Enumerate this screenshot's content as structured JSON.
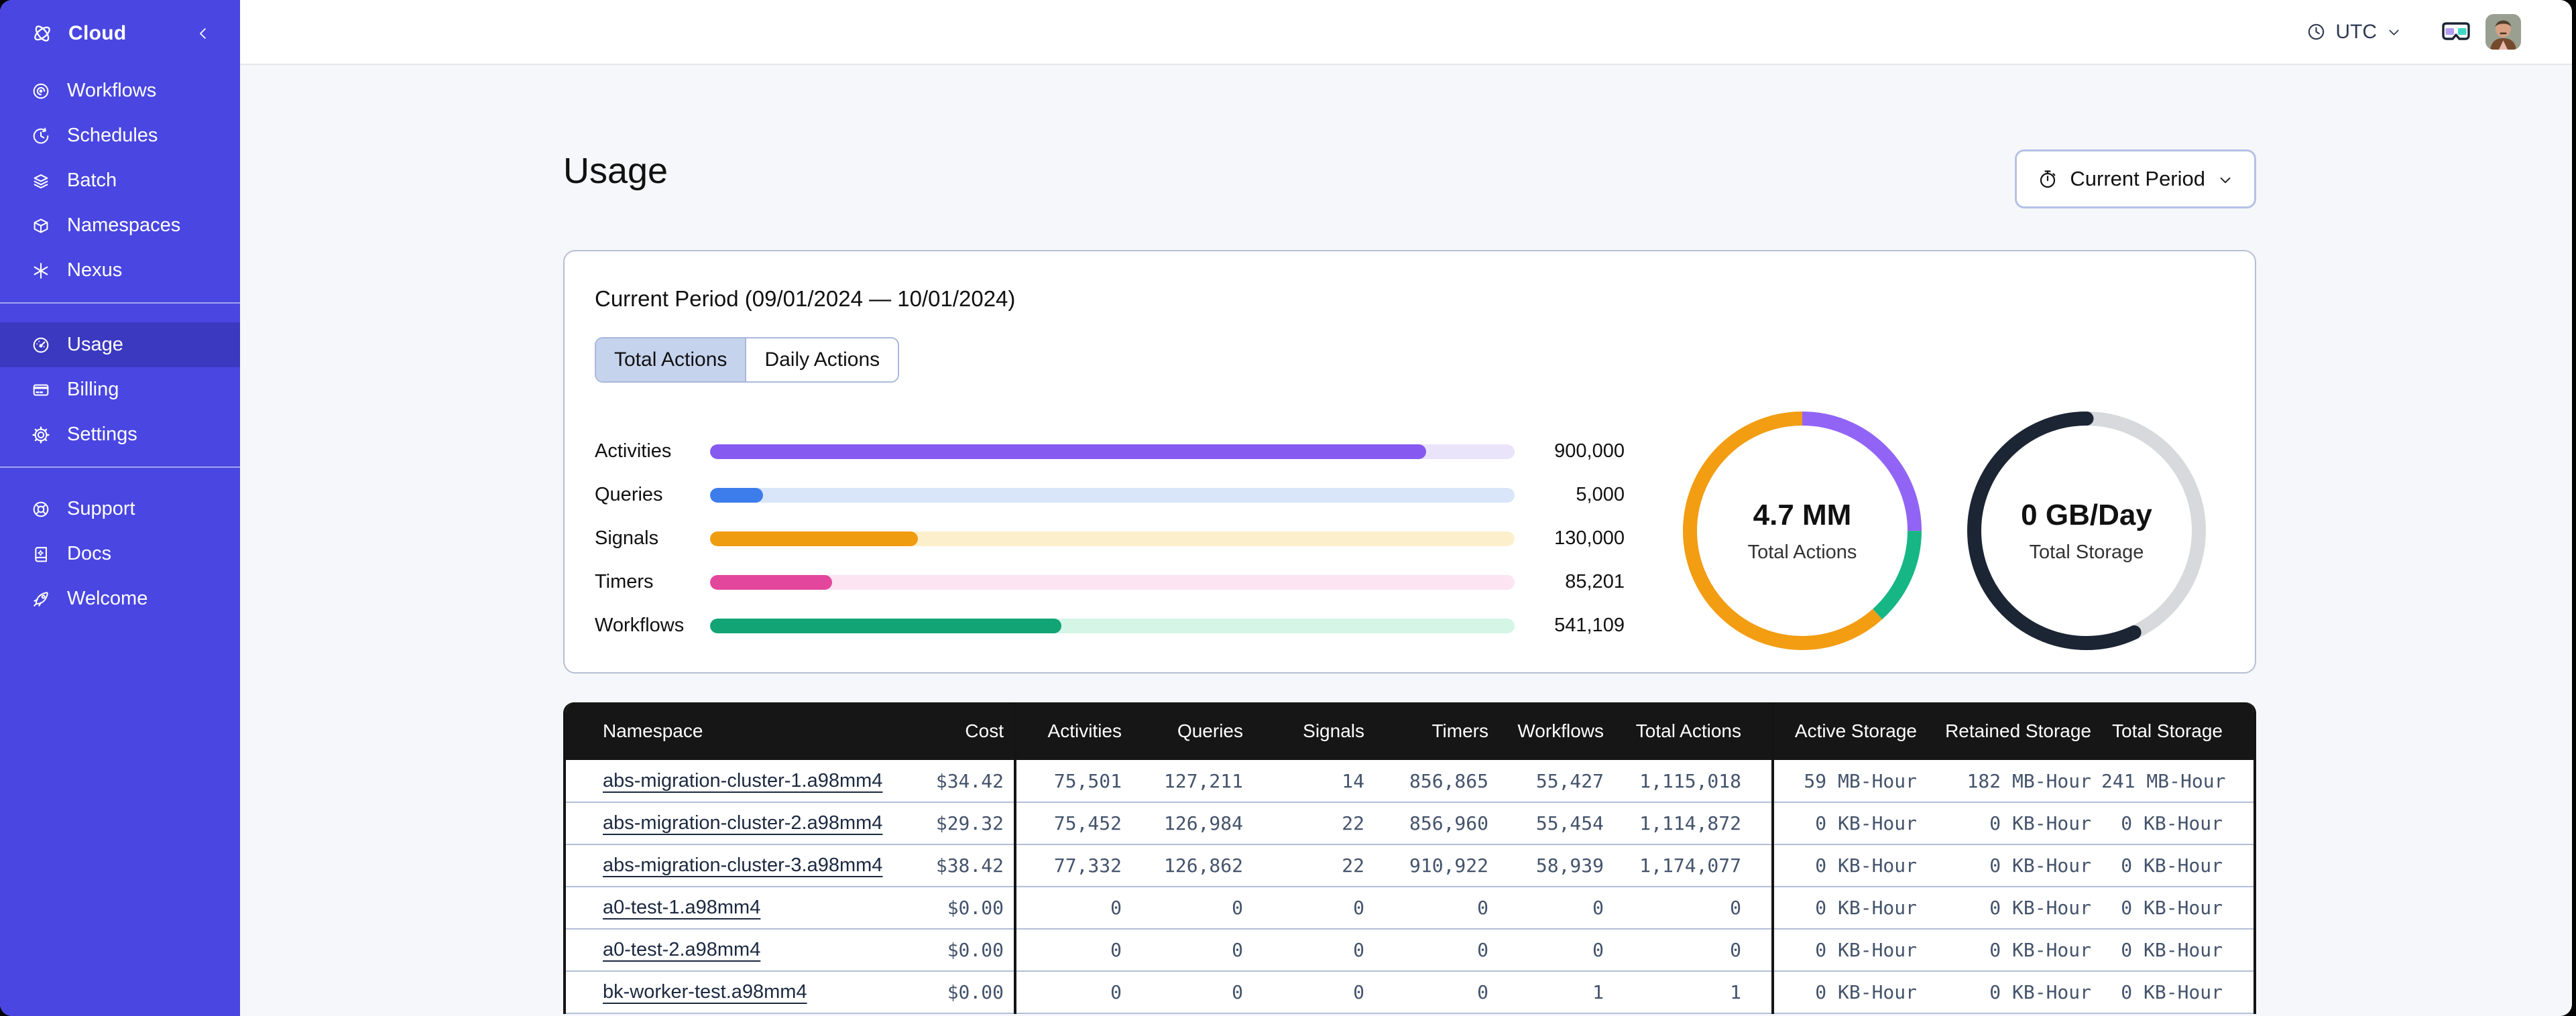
{
  "sidebar": {
    "brand": {
      "label": "Cloud"
    },
    "groups": [
      {
        "items": [
          {
            "icon": "workflows-icon",
            "label": "Workflows",
            "active": false
          },
          {
            "icon": "schedules-icon",
            "label": "Schedules",
            "active": false
          },
          {
            "icon": "batch-icon",
            "label": "Batch",
            "active": false
          },
          {
            "icon": "namespaces-icon",
            "label": "Namespaces",
            "active": false
          },
          {
            "icon": "nexus-icon",
            "label": "Nexus",
            "active": false
          }
        ]
      },
      {
        "items": [
          {
            "icon": "usage-icon",
            "label": "Usage",
            "active": true
          },
          {
            "icon": "billing-icon",
            "label": "Billing",
            "active": false
          },
          {
            "icon": "settings-icon",
            "label": "Settings",
            "active": false
          }
        ]
      },
      {
        "items": [
          {
            "icon": "support-icon",
            "label": "Support",
            "active": false
          },
          {
            "icon": "docs-icon",
            "label": "Docs",
            "active": false
          },
          {
            "icon": "welcome-icon",
            "label": "Welcome",
            "active": false
          }
        ]
      }
    ]
  },
  "topbar": {
    "timezone": "UTC"
  },
  "page": {
    "title": "Usage",
    "period_button": {
      "label": "Current Period"
    }
  },
  "usage_card": {
    "title": "Current Period (09/01/2024 — 10/01/2024)",
    "tabs": [
      {
        "label": "Total Actions",
        "active": true
      },
      {
        "label": "Daily Actions",
        "active": false
      }
    ]
  },
  "chart_data": [
    {
      "type": "bar",
      "orientation": "horizontal",
      "categories": [
        "Activities",
        "Queries",
        "Signals",
        "Timers",
        "Workflows"
      ],
      "values": [
        900000,
        5000,
        130000,
        85201,
        541109
      ],
      "value_labels": [
        "900,000",
        "5,000",
        "130,000",
        "85,201",
        "541,109"
      ],
      "fill_pct": [
        89,
        6.6,
        25.8,
        15.2,
        43.7
      ],
      "colors": [
        "#8659f0",
        "#3d7ceb",
        "#f09c10",
        "#e2479c",
        "#12a474"
      ],
      "track_colors": [
        "#eae4fb",
        "#d9e6fa",
        "#fcf0cc",
        "#fce4f3",
        "#d5f5e6"
      ],
      "grid": false,
      "legend": "none"
    },
    {
      "type": "donut",
      "center_value": "4.7 MM",
      "center_label": "Total Actions",
      "segments": [
        {
          "name": "activities",
          "color": "#9264f6",
          "pct": 25
        },
        {
          "name": "workflows",
          "color": "#16b685",
          "pct": 13.3
        },
        {
          "name": "signals",
          "color": "#f29d12",
          "pct": 61.7
        }
      ]
    },
    {
      "type": "donut",
      "center_value": "0 GB/Day",
      "center_label": "Total Storage",
      "segments": [
        {
          "name": "remaining",
          "color": "#d8d9dd",
          "pct": 43,
          "cap": "butt"
        },
        {
          "name": "used",
          "color": "#1b2534",
          "pct": 57,
          "cap": "round"
        }
      ]
    }
  ],
  "table": {
    "columns": [
      {
        "key": "namespace",
        "label": "Namespace"
      },
      {
        "key": "cost",
        "label": "Cost"
      },
      {
        "key": "activities",
        "label": "Activities"
      },
      {
        "key": "queries",
        "label": "Queries"
      },
      {
        "key": "signals",
        "label": "Signals"
      },
      {
        "key": "timers",
        "label": "Timers"
      },
      {
        "key": "workflows",
        "label": "Workflows"
      },
      {
        "key": "total-actions",
        "label": "Total Actions"
      },
      {
        "key": "active-storage",
        "label": "Active Storage"
      },
      {
        "key": "retained-storage",
        "label": "Retained Storage"
      },
      {
        "key": "total-storage",
        "label": "Total Storage"
      }
    ],
    "rows": [
      [
        "abs-migration-cluster-1.a98mm4",
        "$34.42",
        "75,501",
        "127,211",
        "14",
        "856,865",
        "55,427",
        "1,115,018",
        "59 MB-Hour",
        "182 MB-Hour",
        "241 MB-Hour"
      ],
      [
        "abs-migration-cluster-2.a98mm4",
        "$29.32",
        "75,452",
        "126,984",
        "22",
        "856,960",
        "55,454",
        "1,114,872",
        "0 KB-Hour",
        "0 KB-Hour",
        "0 KB-Hour"
      ],
      [
        "abs-migration-cluster-3.a98mm4",
        "$38.42",
        "77,332",
        "126,862",
        "22",
        "910,922",
        "58,939",
        "1,174,077",
        "0 KB-Hour",
        "0 KB-Hour",
        "0 KB-Hour"
      ],
      [
        "a0-test-1.a98mm4",
        "$0.00",
        "0",
        "0",
        "0",
        "0",
        "0",
        "0",
        "0 KB-Hour",
        "0 KB-Hour",
        "0 KB-Hour"
      ],
      [
        "a0-test-2.a98mm4",
        "$0.00",
        "0",
        "0",
        "0",
        "0",
        "0",
        "0",
        "0 KB-Hour",
        "0 KB-Hour",
        "0 KB-Hour"
      ],
      [
        "bk-worker-test.a98mm4",
        "$0.00",
        "0",
        "0",
        "0",
        "0",
        "1",
        "1",
        "0 KB-Hour",
        "0 KB-Hour",
        "0 KB-Hour"
      ]
    ]
  }
}
